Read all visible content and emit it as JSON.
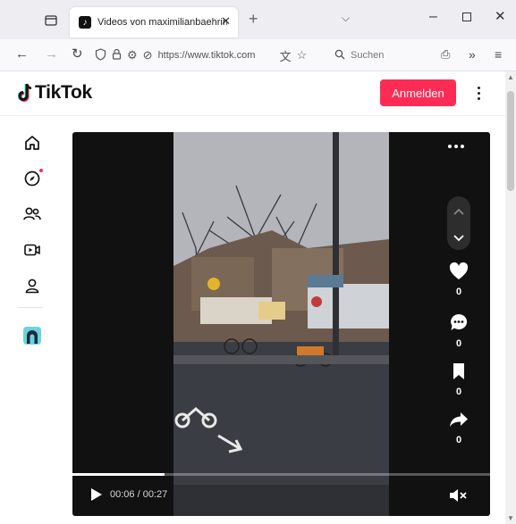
{
  "browser": {
    "tab": {
      "title": "Videos von maximilianbaehring"
    },
    "url": "https://www.tiktok.com",
    "search_placeholder": "Suchen"
  },
  "tiktok": {
    "logo_text": "TikTok",
    "login_label": "Anmelden",
    "sidebar": [
      {
        "icon": "home-icon"
      },
      {
        "icon": "explore-icon",
        "has_dot": true
      },
      {
        "icon": "following-icon"
      },
      {
        "icon": "live-icon"
      },
      {
        "icon": "profile-icon"
      },
      {
        "icon": "avatar-icon"
      }
    ]
  },
  "player": {
    "counts": {
      "likes": "0",
      "comments": "0",
      "saves": "0",
      "shares": "0"
    },
    "time_current": "00:06",
    "time_total": "00:27",
    "time_text": "00:06 / 00:27",
    "progress": 0.22
  },
  "colors": {
    "accent": "#fe2c55",
    "player_bg": "#111111"
  }
}
